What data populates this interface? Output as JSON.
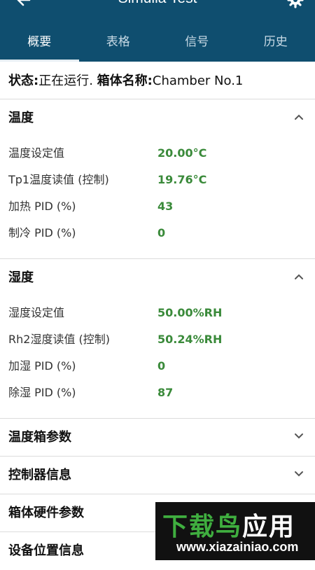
{
  "appbar": {
    "title": "Simulia Test",
    "back_icon": "arrow-left-icon",
    "settings_icon": "gear-icon",
    "bg_color": "#0f4e6f"
  },
  "tabs": [
    {
      "label": "概要",
      "active": true
    },
    {
      "label": "表格",
      "active": false
    },
    {
      "label": "信号",
      "active": false
    },
    {
      "label": "历史",
      "active": false
    }
  ],
  "status": {
    "state_label": "状态:",
    "state_value": "正在运行.",
    "name_label": "箱体名称:",
    "name_value": "Chamber No.1"
  },
  "sections": {
    "temperature": {
      "title": "温度",
      "expanded": true,
      "rows": [
        {
          "label": "温度设定值",
          "value": "20.00°C"
        },
        {
          "label": "Tp1温度读值 (控制)",
          "value": "19.76°C"
        },
        {
          "label": "加热 PID (%)",
          "value": "43"
        },
        {
          "label": "制冷 PID (%)",
          "value": "0"
        }
      ]
    },
    "humidity": {
      "title": "湿度",
      "expanded": true,
      "rows": [
        {
          "label": "湿度设定值",
          "value": "50.00%RH"
        },
        {
          "label": "Rh2湿度读值 (控制)",
          "value": "50.24%RH"
        },
        {
          "label": "加湿 PID (%)",
          "value": "0"
        },
        {
          "label": "除湿 PID (%)",
          "value": "87"
        }
      ]
    },
    "chamber_params": {
      "title": "温度箱参数",
      "expanded": false
    },
    "controller_info": {
      "title": "控制器信息",
      "expanded": false
    },
    "hardware_params": {
      "title": "箱体硬件参数",
      "expanded": false
    },
    "location_info": {
      "title": "设备位置信息",
      "expanded": false
    }
  },
  "value_color": "#3a8a3a",
  "watermark": {
    "logo_a": "下载鸟",
    "logo_b": "应用",
    "url": "www.xiazainiao.com"
  }
}
